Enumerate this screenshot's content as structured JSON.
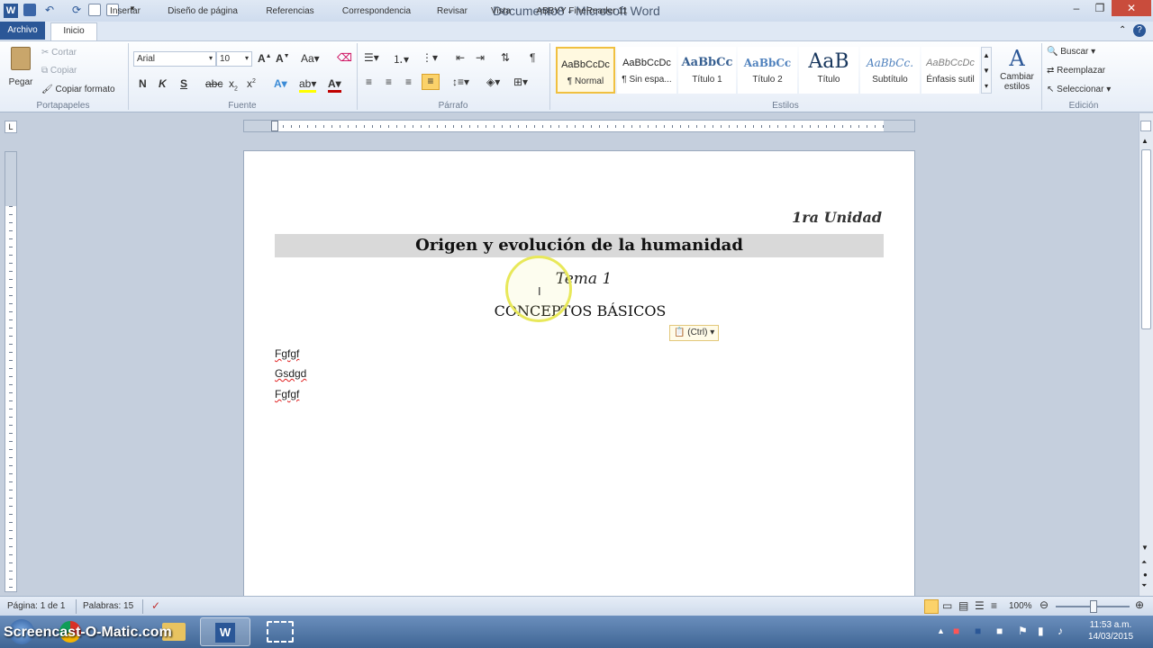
{
  "window": {
    "title": "Documento8 - Microsoft Word",
    "minimize": "–",
    "restore": "❐",
    "close": "✕"
  },
  "tabs": [
    "Archivo",
    "Inicio",
    "Insertar",
    "Diseño de página",
    "Referencias",
    "Correspondencia",
    "Revisar",
    "Vista",
    "ABBYY FineReader 11"
  ],
  "clipboard": {
    "paste": "Pegar",
    "cut": "Cortar",
    "copy": "Copiar",
    "format_painter": "Copiar formato",
    "group": "Portapapeles"
  },
  "font": {
    "name": "Arial",
    "size": "10",
    "group": "Fuente",
    "bold": "N",
    "italic": "K",
    "underline": "S"
  },
  "paragraph": {
    "group": "Párrafo",
    "pilcrow": "¶"
  },
  "styles": {
    "group": "Estilos",
    "items": [
      {
        "sample": "AaBbCcDc",
        "name": "¶ Normal"
      },
      {
        "sample": "AaBbCcDc",
        "name": "¶ Sin espa..."
      },
      {
        "sample": "AaBbCc",
        "name": "Título 1"
      },
      {
        "sample": "AaBbCc",
        "name": "Título 2"
      },
      {
        "sample": "AaB",
        "name": "Título"
      },
      {
        "sample": "AaBbCc.",
        "name": "Subtítulo"
      },
      {
        "sample": "AaBbCcDc",
        "name": "Énfasis sutil"
      }
    ],
    "change": "Cambiar estilos"
  },
  "editing": {
    "group": "Edición",
    "find": "Buscar",
    "replace": "Reemplazar",
    "select": "Seleccionar"
  },
  "document": {
    "unit": "1ra Unidad",
    "heading": "Origen y evolución de la humanidad",
    "tema": "Tema 1",
    "concepts": "CONCEPTOS BÁSICOS",
    "paste_options": "(Ctrl)",
    "lines": [
      "Fgfgf",
      "Gsdgd",
      "Fgfgf"
    ]
  },
  "status": {
    "page": "Página: 1 de 1",
    "words": "Palabras: 15",
    "zoom": "100%"
  },
  "taskbar": {
    "watermark": "Screencast-O-Matic.com",
    "time": "11:53 a.m.",
    "date": "14/03/2015"
  },
  "colors": {
    "accent": "#2b5797",
    "heading_band": "#d9d9d9",
    "highlight_ring": "#e8e85a"
  }
}
